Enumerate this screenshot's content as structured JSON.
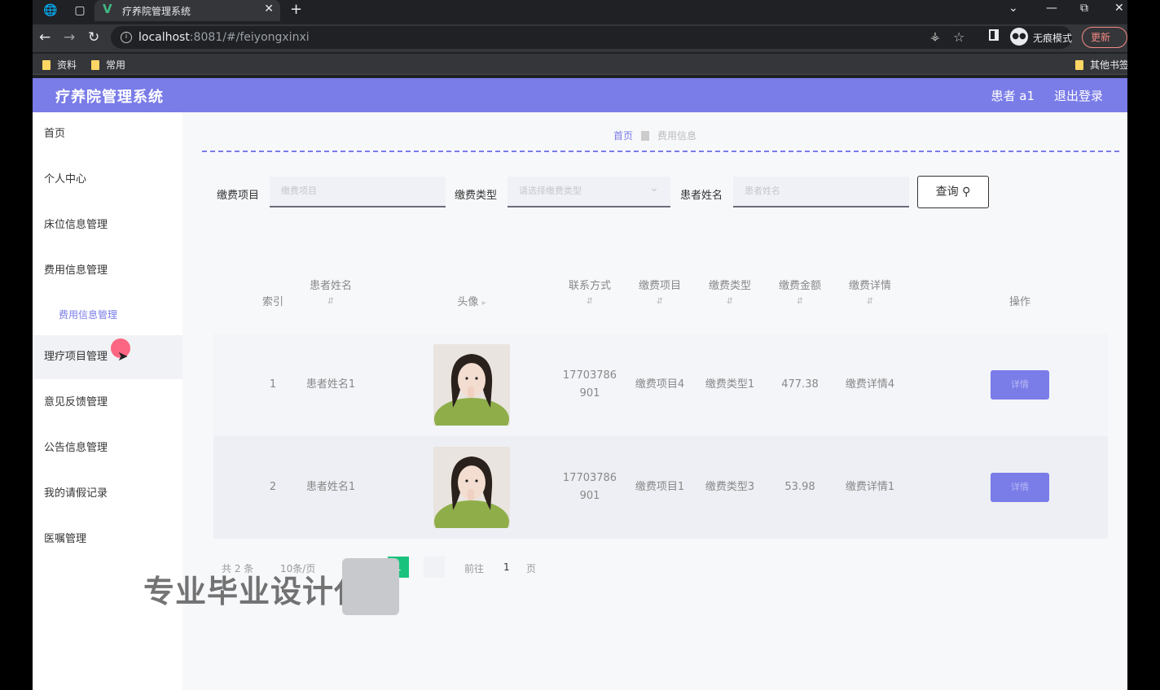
{
  "browser": {
    "tab_title": "疗养院管理系统",
    "url_host": "localhost",
    "url_rest": ":8081/#/feiyongxinxi",
    "incognito_label": "无痕模式",
    "update_label": "更新",
    "bookmarks": [
      "资料",
      "常用",
      "其他书签"
    ]
  },
  "app": {
    "title": "疗养院管理系统",
    "user": "患者 a1",
    "logout": "退出登录",
    "accent_color": "#7a7ce8"
  },
  "sidebar": {
    "items": [
      "首页",
      "个人中心",
      "床位信息管理",
      "费用信息管理",
      "理疗项目管理",
      "意见反馈管理",
      "公告信息管理",
      "我的请假记录",
      "医嘱管理"
    ],
    "sub_item": "费用信息管理"
  },
  "breadcrumb": {
    "home": "首页",
    "current": "费用信息"
  },
  "search": {
    "label1": "缴费项目",
    "placeholder1": "缴费项目",
    "label2": "缴费类型",
    "placeholder2": "请选择缴费类型",
    "label3": "患者姓名",
    "placeholder3": "患者姓名",
    "query_label": "查询"
  },
  "table": {
    "headers": [
      "索引",
      "患者姓名",
      "头像",
      "联系方式",
      "缴费项目",
      "缴费类型",
      "缴费金额",
      "缴费详情",
      "操作"
    ],
    "rows": [
      {
        "index": "1",
        "name": "患者姓名1",
        "phone_a": "17703786",
        "phone_b": "901",
        "item": "缴费项目4",
        "type": "缴费类型1",
        "amount": "477.38",
        "detail": "缴费详情4",
        "action": "详情"
      },
      {
        "index": "2",
        "name": "患者姓名1",
        "phone_a": "17703786",
        "phone_b": "901",
        "item": "缴费项目1",
        "type": "缴费类型3",
        "amount": "53.98",
        "detail": "缴费详情1",
        "action": "详情"
      }
    ]
  },
  "pagination": {
    "total": "共 2 条",
    "page_size": "10条/页",
    "current_page": "1",
    "goto_label": "前往",
    "goto_value": "1",
    "page_unit": "页"
  },
  "overlay": {
    "watermark": "专业毕业设计代做"
  }
}
